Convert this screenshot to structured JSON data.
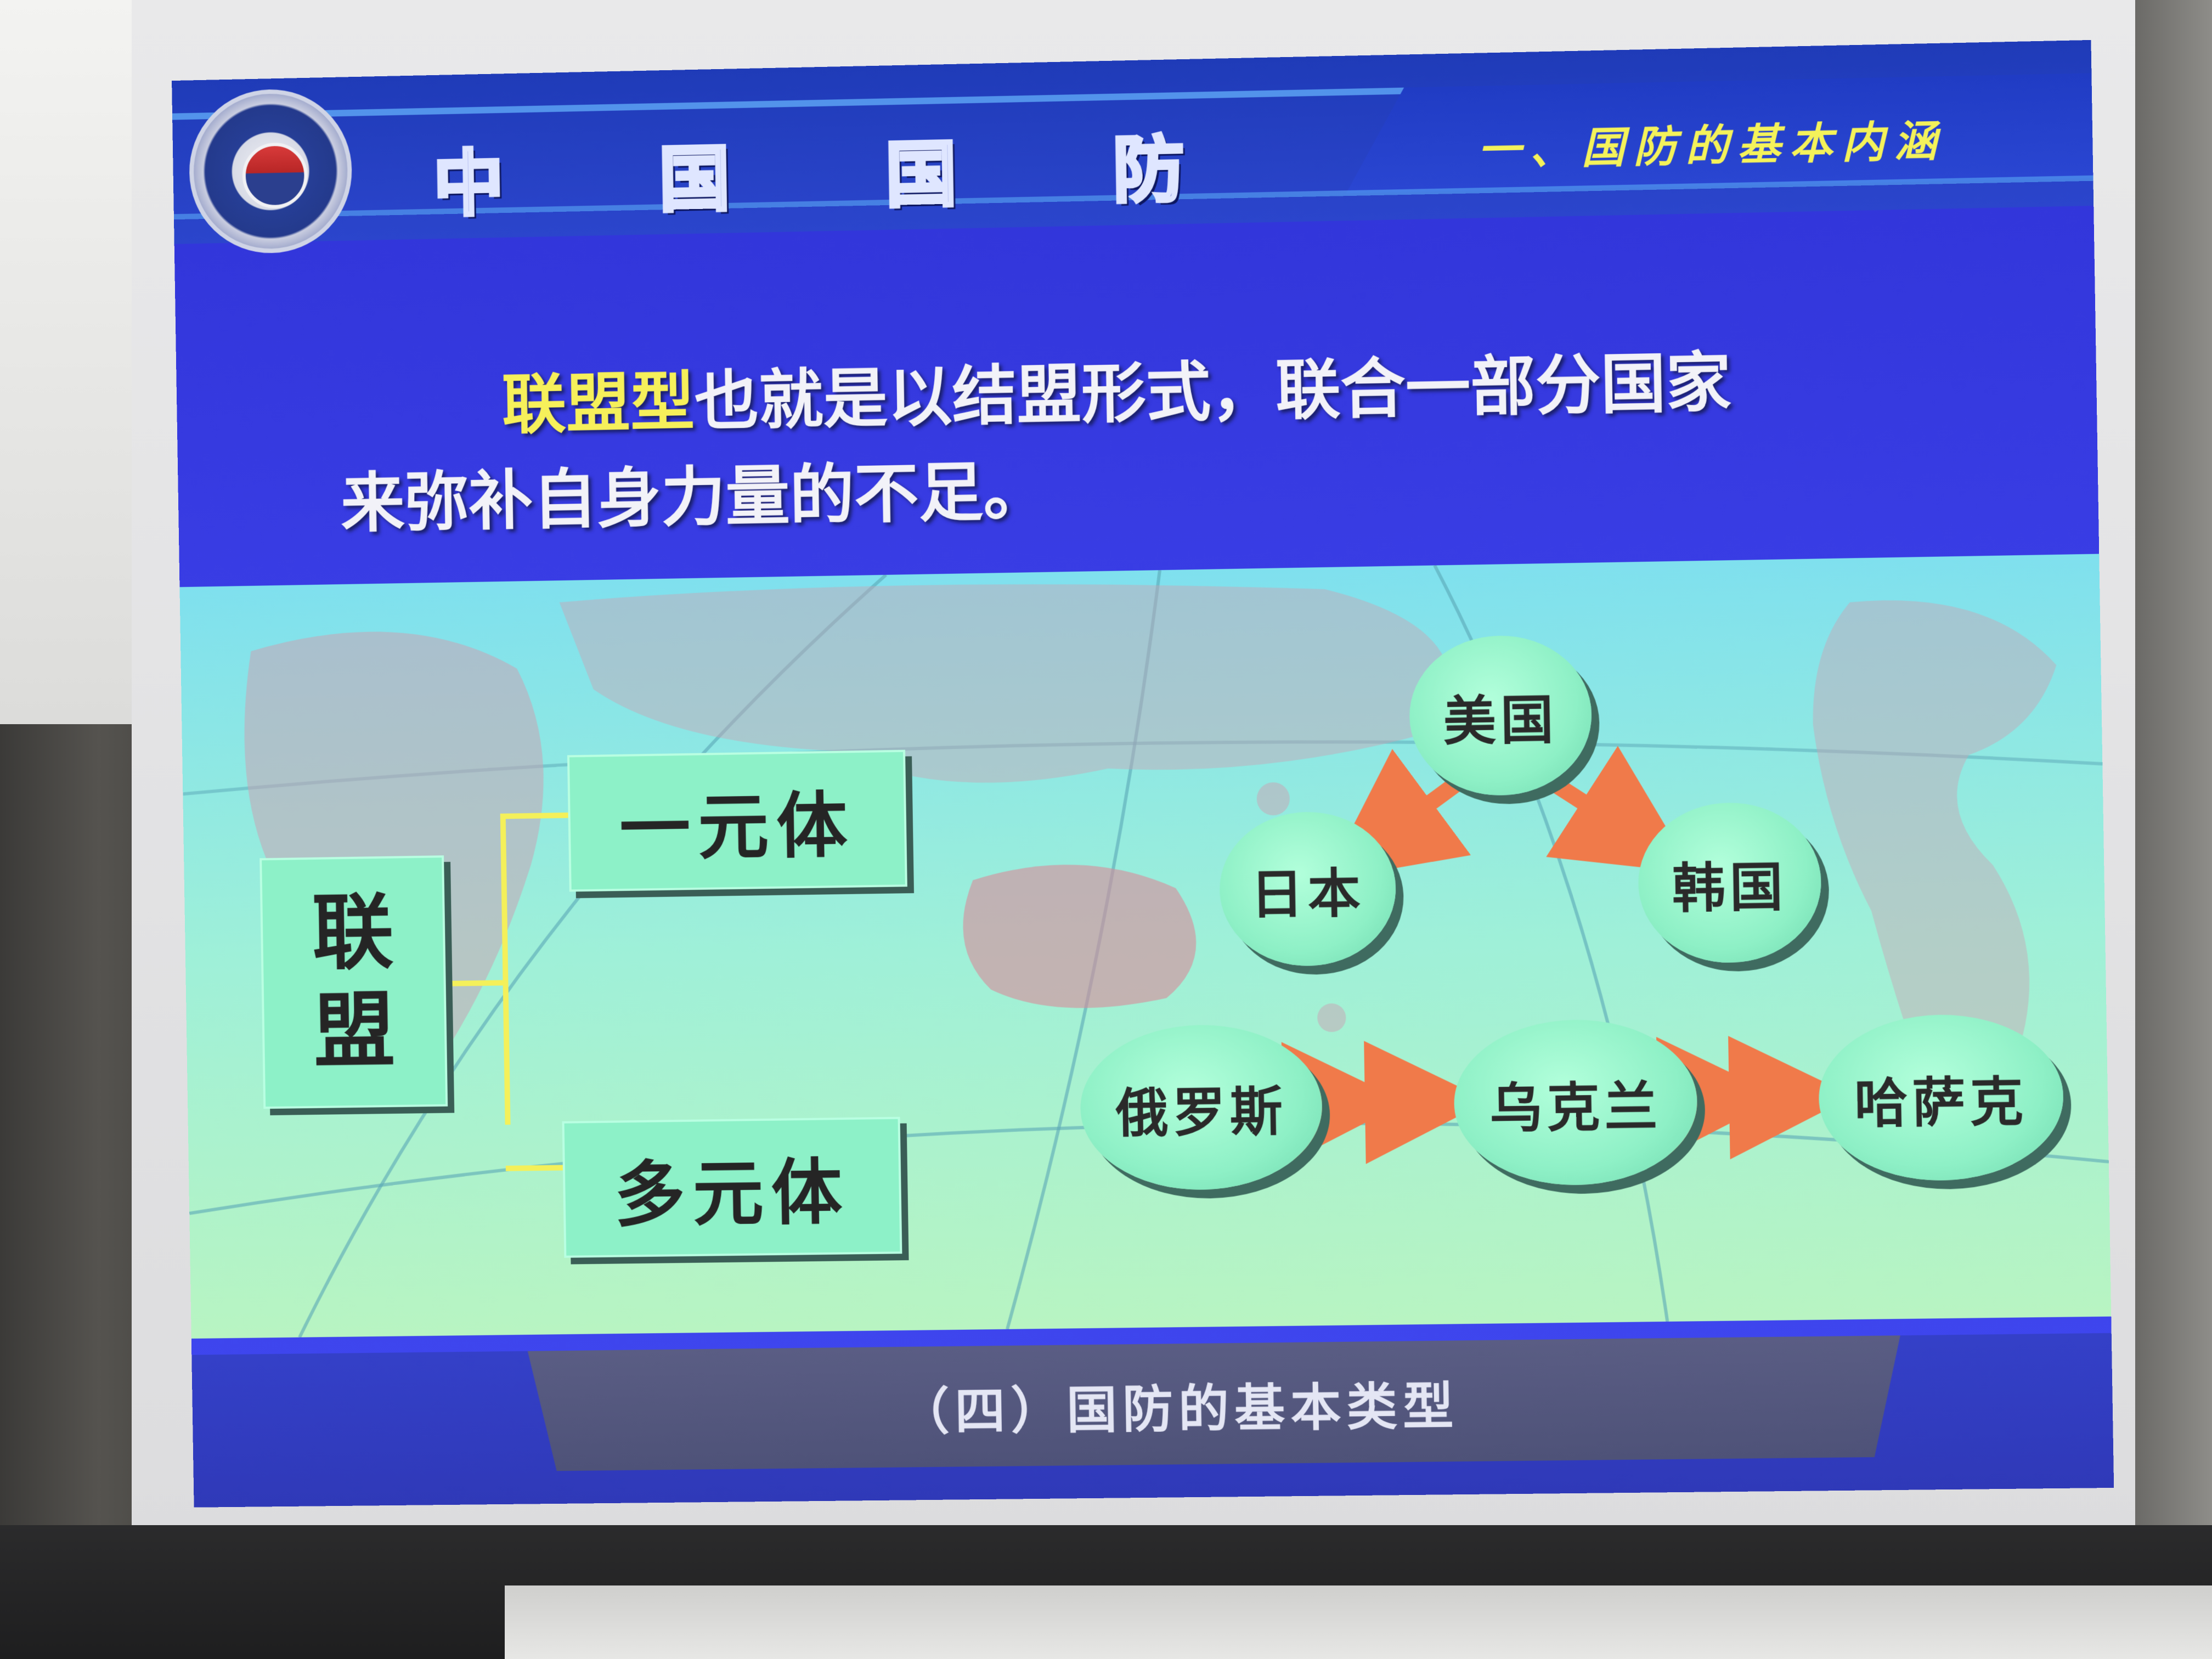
{
  "slide": {
    "title": "中 国 国 防",
    "section": "一、国防的基本内涵",
    "body_highlight": "联盟型",
    "body_line1": "也就是以结盟形式，联合一部分国家",
    "body_line2": "来弥补自身力量的不足。",
    "footer": "（四）国防的基本类型"
  },
  "diagram": {
    "root_char1": "联",
    "root_char2": "盟",
    "branch_one": "一元体",
    "branch_multi": "多元体",
    "nodes": {
      "usa": "美国",
      "japan": "日本",
      "korea": "韩国",
      "russia": "俄罗斯",
      "ukraine": "乌克兰",
      "kazakhstan": "哈萨克"
    }
  },
  "colors": {
    "slide_blue": "#3a3ee6",
    "highlight_yellow": "#f6f05a",
    "box_green": "#8df1c8",
    "arrow_orange": "#f07a4a"
  }
}
